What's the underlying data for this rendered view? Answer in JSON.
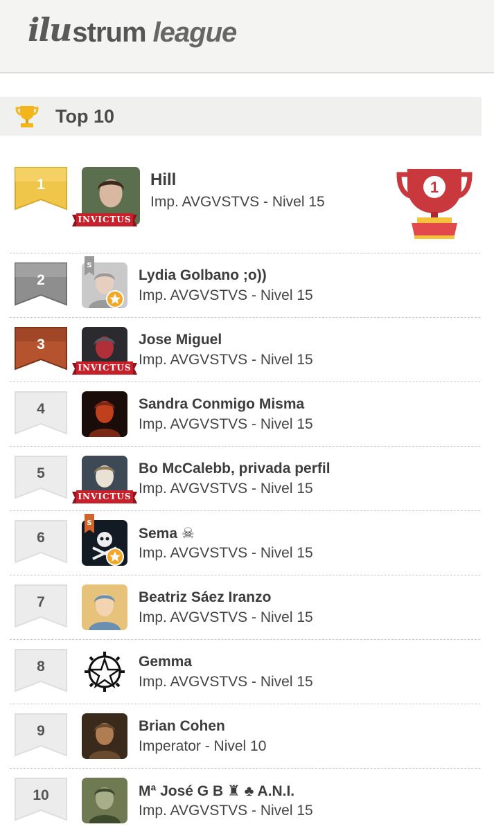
{
  "header": {
    "logo_mark": "ilu",
    "logo_word1": "strum",
    "logo_word2": "league"
  },
  "section": {
    "title": "Top 10",
    "icon": "trophy-icon"
  },
  "badge_label": "INVICTUS",
  "big_trophy_number": "1",
  "players": [
    {
      "position": "1",
      "name": "Hill",
      "rank": "Imp. AVGVSTVS - Nivel 15",
      "medal": "gold",
      "invictus": true,
      "star": false,
      "s_tag": false
    },
    {
      "position": "2",
      "name": "Lydia Golbano ;o))",
      "rank": "Imp. AVGVSTVS - Nivel 15",
      "medal": "silver",
      "invictus": false,
      "star": true,
      "s_tag": true
    },
    {
      "position": "3",
      "name": "Jose Miguel",
      "rank": "Imp. AVGVSTVS - Nivel 15",
      "medal": "bronze",
      "invictus": true,
      "star": false,
      "s_tag": false
    },
    {
      "position": "4",
      "name": "Sandra Conmigo Misma",
      "rank": "Imp. AVGVSTVS - Nivel 15",
      "medal": "plain",
      "invictus": false,
      "star": false,
      "s_tag": false
    },
    {
      "position": "5",
      "name": "Bo McCalebb, privada perfil",
      "rank": "Imp. AVGVSTVS - Nivel 15",
      "medal": "plain",
      "invictus": true,
      "star": false,
      "s_tag": false
    },
    {
      "position": "6",
      "name": "Sema ☠",
      "rank": "Imp. AVGVSTVS - Nivel 15",
      "medal": "plain",
      "invictus": false,
      "star": true,
      "s_tag": true
    },
    {
      "position": "7",
      "name": "Beatriz Sáez Iranzo",
      "rank": "Imp. AVGVSTVS - Nivel 15",
      "medal": "plain",
      "invictus": false,
      "star": false,
      "s_tag": false
    },
    {
      "position": "8",
      "name": "Gemma",
      "rank": "Imp. AVGVSTVS - Nivel 15",
      "medal": "plain",
      "invictus": false,
      "star": false,
      "s_tag": false
    },
    {
      "position": "9",
      "name": "Brian Cohen",
      "rank": "Imperator - Nivel 10",
      "medal": "plain",
      "invictus": false,
      "star": false,
      "s_tag": false
    },
    {
      "position": "10",
      "name": "Mª José G B ♜ ♣ A.N.I.",
      "rank": "Imp. AVGVSTVS - Nivel 15",
      "medal": "plain",
      "invictus": false,
      "star": false,
      "s_tag": false
    }
  ],
  "colors": {
    "gold": "#f0c64a",
    "silver": "#8e8e8e",
    "bronze": "#b5532f",
    "plain": "#ececec",
    "invictus_red": "#c8202a",
    "trophy_red": "#c8383c",
    "star_orange": "#f5a623"
  }
}
